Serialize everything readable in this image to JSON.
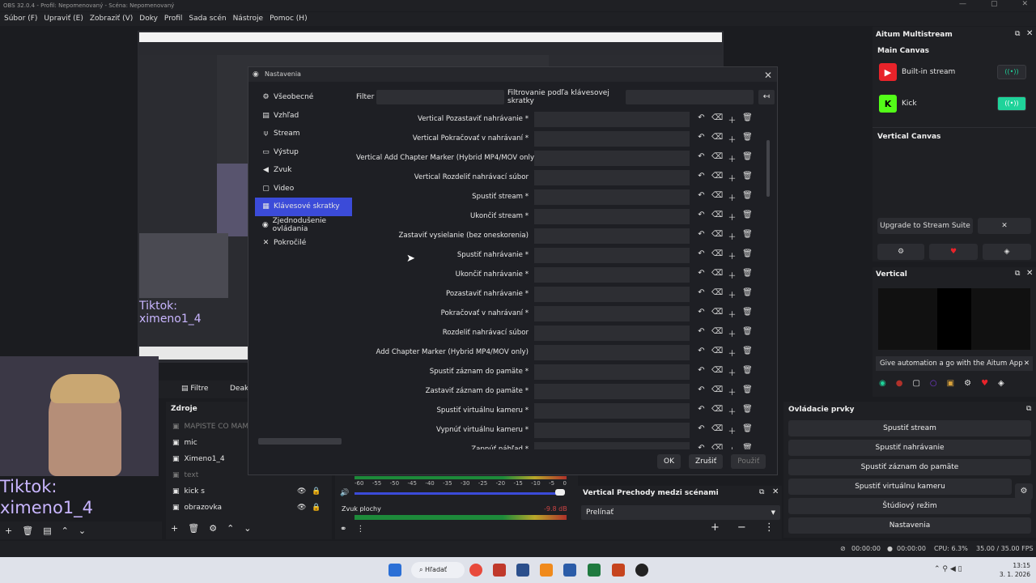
{
  "window": {
    "title": "OBS 32.0.4 - Profil: Nepomenovaný - Scéna: Nepomenovaný"
  },
  "menubar": [
    "Súbor (F)",
    "Upraviť (E)",
    "Zobraziť (V)",
    "Doky",
    "Profil",
    "Sada scén",
    "Nástroje",
    "Pomoc (H)"
  ],
  "preview": {
    "tiktok_small": "Tiktok:\nximeno1_4",
    "tiktok_big": "Tiktok:\nximeno1_4"
  },
  "dialog": {
    "title": "Nastavenia",
    "sidebar": [
      {
        "label": "Všeobecné",
        "icon": "gear-icon",
        "glyph": "⚙"
      },
      {
        "label": "Vzhľad",
        "icon": "brush-icon",
        "glyph": "▤"
      },
      {
        "label": "Stream",
        "icon": "antenna-icon",
        "glyph": "⍦"
      },
      {
        "label": "Výstup",
        "icon": "output-icon",
        "glyph": "▭"
      },
      {
        "label": "Zvuk",
        "icon": "speaker-icon",
        "glyph": "◀"
      },
      {
        "label": "Video",
        "icon": "monitor-icon",
        "glyph": "▢"
      },
      {
        "label": "Klávesové skratky",
        "icon": "keyboard-icon",
        "glyph": "▦",
        "active": true
      },
      {
        "label": "Zjednodušenie ovládania",
        "icon": "accessibility-icon",
        "glyph": "◉"
      },
      {
        "label": "Pokročilé",
        "icon": "wrench-icon",
        "glyph": "✕"
      }
    ],
    "filter_label": "Filter",
    "filter_hotkey_label": "Filtrovanie podľa klávesovej skratky",
    "hotkeys": [
      "Vertical Pozastaviť nahrávanie *",
      "Vertical Pokračovať v nahrávaní *",
      "Vertical Add Chapter Marker (Hybrid MP4/MOV only)",
      "Vertical Rozdeliť nahrávací súbor",
      "Spustiť stream *",
      "Ukončiť stream *",
      "Zastaviť vysielanie (bez oneskorenia)",
      "Spustiť nahrávanie *",
      "Ukončiť nahrávanie *",
      "Pozastaviť nahrávanie *",
      "Pokračovať v nahrávaní *",
      "Rozdeliť nahrávací súbor",
      "Add Chapter Marker (Hybrid MP4/MOV only)",
      "Spustiť záznam do pamäte *",
      "Zastaviť záznam do pamäte *",
      "Spustiť virtuálnu kameru *",
      "Vypnúť virtuálnu kameru *",
      "Zapnúť náhľad *"
    ],
    "buttons": {
      "ok": "OK",
      "cancel": "Zrušiť",
      "apply": "Použiť"
    }
  },
  "aitum": {
    "title": "Aitum Multistream",
    "main_canvas": "Main Canvas",
    "streams": [
      {
        "name": "Built-in stream",
        "color": "#e8232a",
        "on": false
      },
      {
        "name": "Kick",
        "color": "#53fc18",
        "on": true
      }
    ],
    "vertical_canvas": "Vertical Canvas",
    "upgrade": "Upgrade to Stream Suite",
    "close_x": "✕"
  },
  "vertical": {
    "title": "Vertical",
    "notice": "Give automation a go with the Aitum App"
  },
  "docks": {
    "filters_label": "Filtre",
    "deak_label": "Deakt",
    "sources_title": "Zdroje",
    "sources": [
      {
        "name": "MAPISTE CO MAM R",
        "dim": true
      },
      {
        "name": "mic",
        "dim": false
      },
      {
        "name": "Ximeno1_4",
        "dim": false
      },
      {
        "name": "text",
        "dim": true
      },
      {
        "name": "kick s",
        "dim": false
      },
      {
        "name": "obrazovka",
        "dim": false
      }
    ]
  },
  "audio": {
    "scale": [
      "-60",
      "-55",
      "-50",
      "-45",
      "-40",
      "-35",
      "-30",
      "-25",
      "-20",
      "-15",
      "-10",
      "-5",
      "0"
    ],
    "track": "Zvuk plochy",
    "db": "-9.8 dB"
  },
  "transitions": {
    "title": "Vertical Prechody medzi scénami",
    "selected": "Prelínať"
  },
  "controls": {
    "title": "Ovládacie prvky",
    "buttons": [
      "Spustiť stream",
      "Spustiť nahrávanie",
      "Spustiť záznam do pamäte",
      "Spustiť virtuálnu kameru",
      "Štúdiový režim",
      "Nastavenia"
    ]
  },
  "status": {
    "time1": "00:00:00",
    "time2": "00:00:00",
    "cpu": "CPU: 6.3%",
    "fps": "35.00 / 35.00 FPS"
  },
  "taskbar": {
    "search": "Hľadať",
    "clock_time": "13:15",
    "clock_date": "3. 1. 2026"
  }
}
